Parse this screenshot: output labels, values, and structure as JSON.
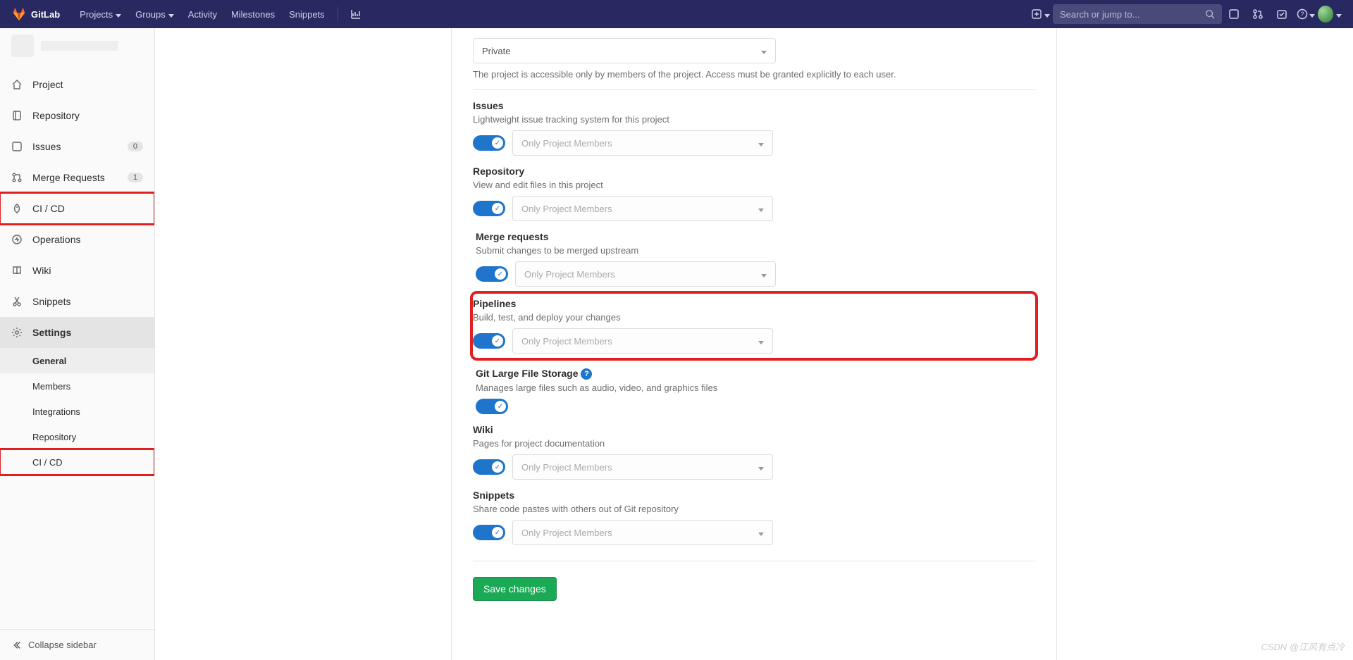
{
  "topnav": {
    "brand": "GitLab",
    "items": [
      "Projects",
      "Groups",
      "Activity",
      "Milestones",
      "Snippets"
    ],
    "search_placeholder": "Search or jump to..."
  },
  "sidebar": {
    "items": [
      {
        "icon": "home",
        "label": "Project"
      },
      {
        "icon": "repo",
        "label": "Repository"
      },
      {
        "icon": "issues",
        "label": "Issues",
        "badge": "0"
      },
      {
        "icon": "merge",
        "label": "Merge Requests",
        "badge": "1"
      },
      {
        "icon": "rocket",
        "label": "CI / CD",
        "highlight": true
      },
      {
        "icon": "ops",
        "label": "Operations"
      },
      {
        "icon": "wiki",
        "label": "Wiki"
      },
      {
        "icon": "snip",
        "label": "Snippets"
      },
      {
        "icon": "gear",
        "label": "Settings",
        "active": true
      }
    ],
    "settings_sub": [
      {
        "label": "General",
        "selected": true
      },
      {
        "label": "Members"
      },
      {
        "label": "Integrations"
      },
      {
        "label": "Repository"
      },
      {
        "label": "CI / CD",
        "highlight": true
      }
    ],
    "collapse": "Collapse sidebar"
  },
  "form": {
    "visibility": {
      "value": "Private",
      "hint": "The project is accessible only by members of the project. Access must be granted explicitly to each user."
    },
    "option_label": "Only Project Members",
    "issues": {
      "title": "Issues",
      "desc": "Lightweight issue tracking system for this project"
    },
    "repo": {
      "title": "Repository",
      "desc": "View and edit files in this project"
    },
    "merge": {
      "title": "Merge requests",
      "desc": "Submit changes to be merged upstream"
    },
    "pipelines": {
      "title": "Pipelines",
      "desc": "Build, test, and deploy your changes"
    },
    "lfs": {
      "title": "Git Large File Storage",
      "desc": "Manages large files such as audio, video, and graphics files"
    },
    "wiki": {
      "title": "Wiki",
      "desc": "Pages for project documentation"
    },
    "snippets": {
      "title": "Snippets",
      "desc": "Share code pastes with others out of Git repository"
    },
    "save": "Save changes"
  },
  "watermark": "CSDN @江风有点冷"
}
